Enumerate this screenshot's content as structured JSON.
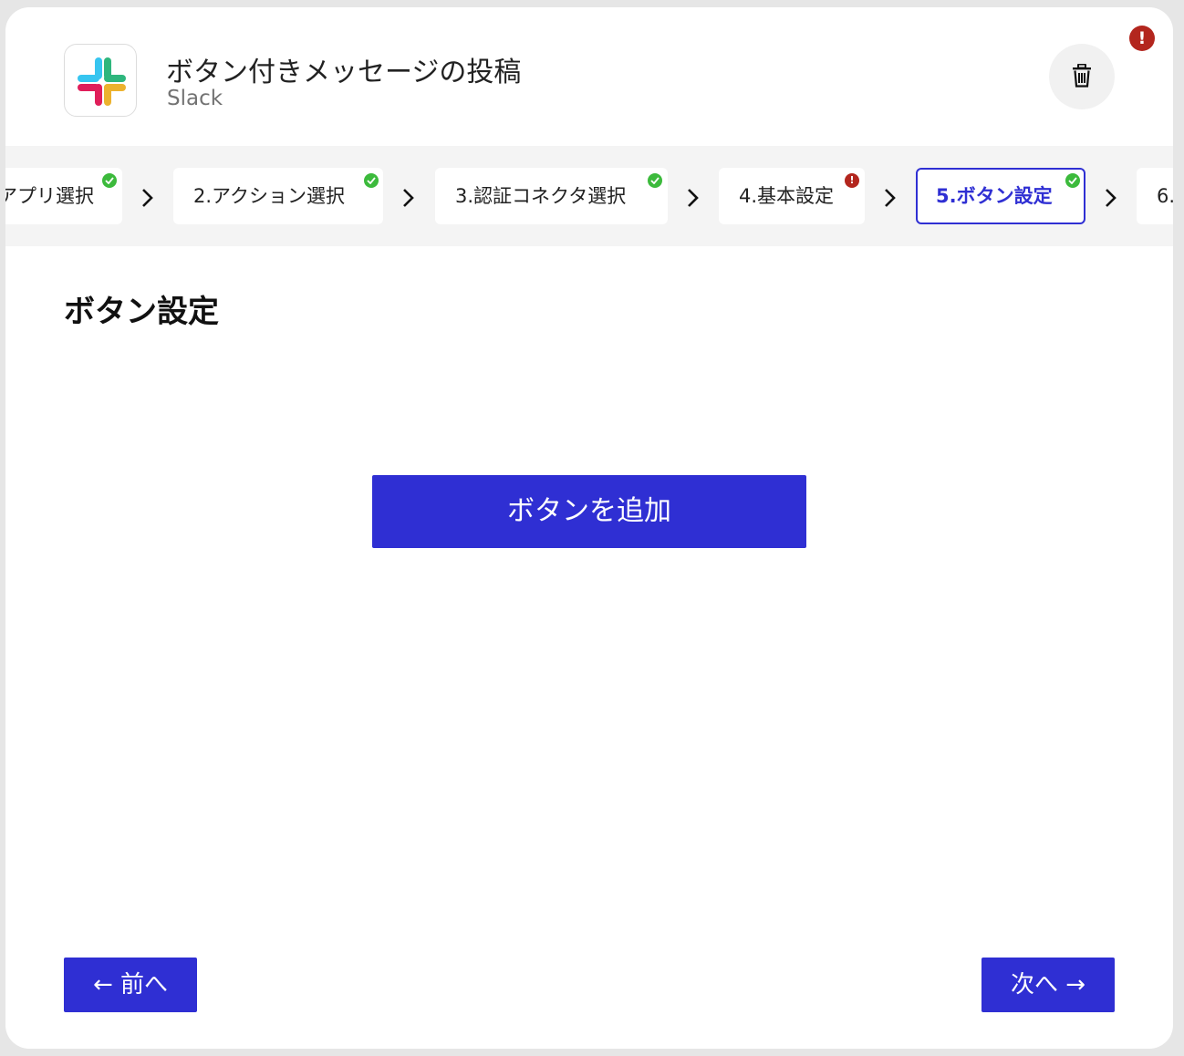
{
  "header": {
    "title": "ボタン付きメッセージの投稿",
    "app_name": "Slack",
    "app_icon": "slack-logo-icon",
    "delete_icon": "trash-icon",
    "alert_badge": "!"
  },
  "steps": [
    {
      "label": "アプリ選択",
      "status": "complete"
    },
    {
      "label": "2.アクション選択",
      "status": "complete"
    },
    {
      "label": "3.認証コネクタ選択",
      "status": "complete"
    },
    {
      "label": "4.基本設定",
      "status": "error",
      "badge": "!"
    },
    {
      "label": "5.ボタン設定",
      "status": "complete",
      "active": true
    },
    {
      "label": "6.",
      "status": "pending"
    }
  ],
  "main": {
    "section_title": "ボタン設定",
    "add_button_label": "ボタンを追加"
  },
  "footer": {
    "prev_label": "← 前へ",
    "next_label": "次へ →"
  },
  "colors": {
    "primary": "#2f2fd3",
    "success": "#3cba3c",
    "error": "#b3261e",
    "stepper_bg": "#f4f4f4"
  }
}
